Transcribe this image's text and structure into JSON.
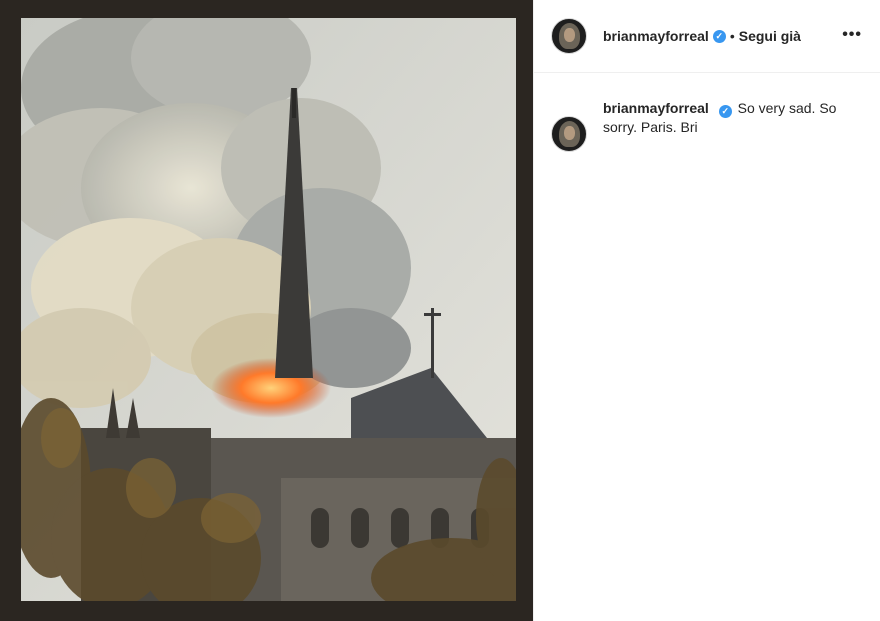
{
  "post": {
    "author": "brianmayforreal",
    "follow_status": "Segui già",
    "separator": "•",
    "more_options": "•••",
    "verified_mark": "✓",
    "caption": "So very sad. So sorry. Paris. Bri"
  },
  "colors": {
    "verified_blue": "#3897f0",
    "media_frame": "#2b2621",
    "text": "#262626"
  },
  "icons": {
    "verified": "verified-badge-icon",
    "more": "more-options-icon"
  }
}
